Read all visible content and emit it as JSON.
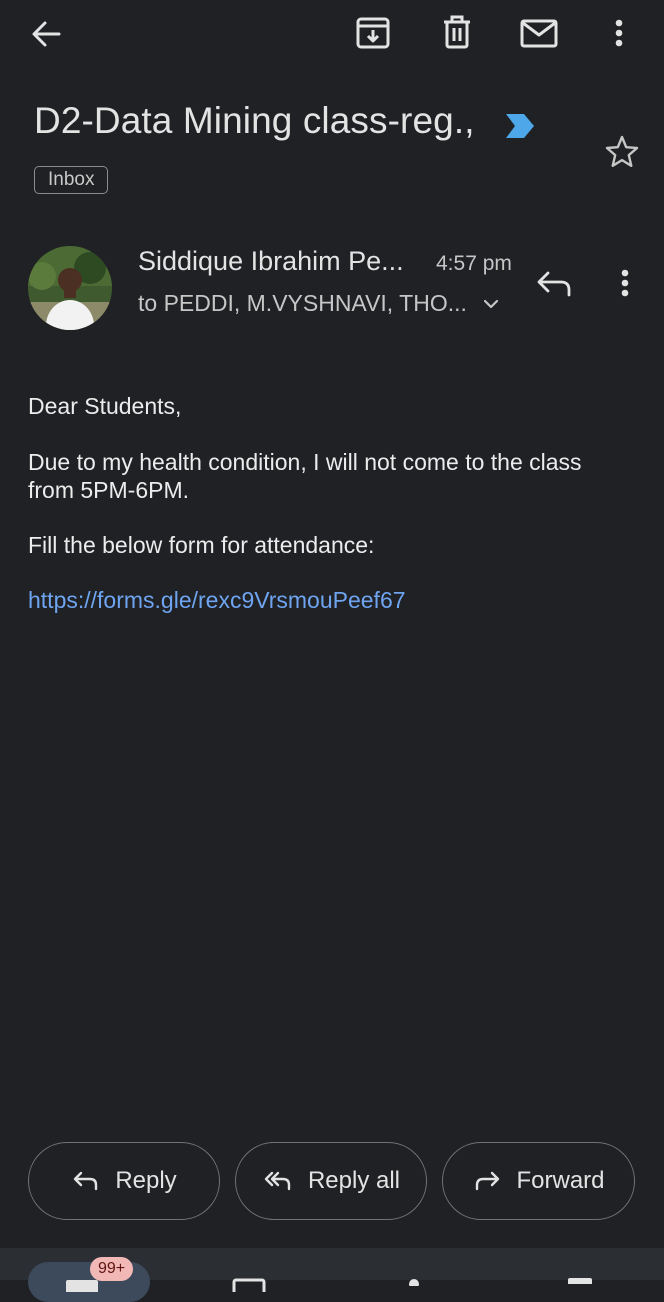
{
  "toolbar": {
    "back_icon": "back-arrow-icon",
    "archive_icon": "archive-icon",
    "delete_icon": "trash-icon",
    "mark_unread_icon": "mail-icon",
    "more_icon": "more-vert-icon"
  },
  "email": {
    "subject": "D2-Data Mining class-reg.,",
    "important_icon": "importance-marker-icon",
    "label": "Inbox",
    "starred": false
  },
  "message": {
    "sender": "Siddique Ibrahim Pe...",
    "time": "4:57 pm",
    "recipients": "to PEDDI, M.VYSHNAVI, THO...",
    "body": {
      "greeting": "Dear Students,",
      "para1_line1": "Due to my health condition, I will not come to the class",
      "para1_line2": "from 5PM-6PM.",
      "para2": "Fill the below form for attendance:",
      "link": "https://forms.gle/rexc9VrsmouPeef67"
    }
  },
  "actions": {
    "reply": "Reply",
    "reply_all": "Reply all",
    "forward": "Forward"
  },
  "bottom_nav": {
    "mail_badge": "99+"
  },
  "colors": {
    "background": "#1f2124",
    "link": "#6ea4f0",
    "important_marker": "#4ea7e8",
    "badge_bg": "#f2b8b5"
  }
}
